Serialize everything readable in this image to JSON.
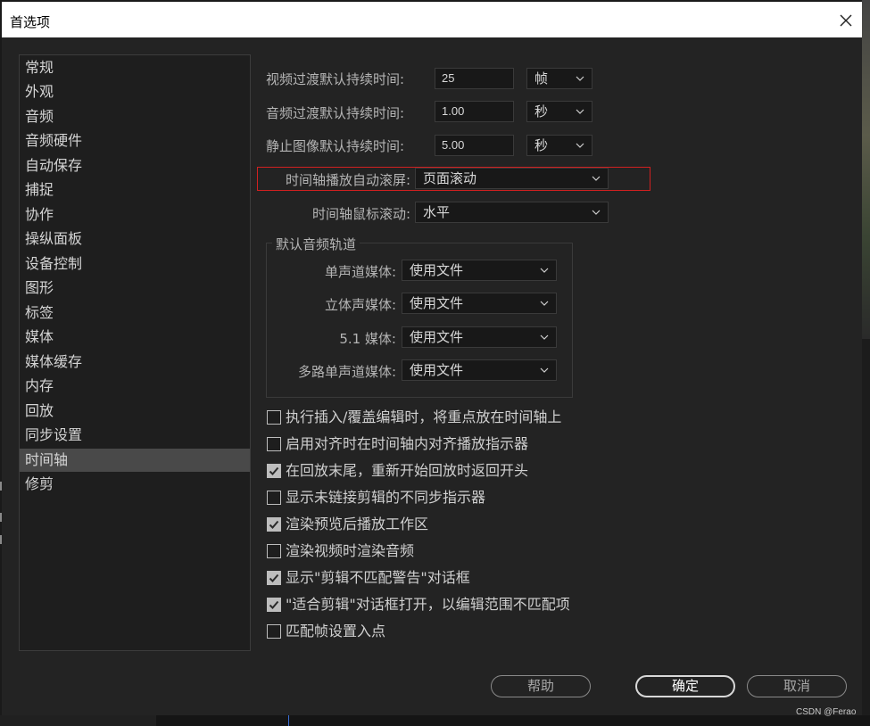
{
  "window": {
    "title": "首选项",
    "close_icon": "close-icon"
  },
  "sidebar": {
    "items": [
      {
        "label": "常规"
      },
      {
        "label": "外观"
      },
      {
        "label": "音频"
      },
      {
        "label": "音频硬件"
      },
      {
        "label": "自动保存"
      },
      {
        "label": "捕捉"
      },
      {
        "label": "协作"
      },
      {
        "label": "操纵面板"
      },
      {
        "label": "设备控制"
      },
      {
        "label": "图形"
      },
      {
        "label": "标签"
      },
      {
        "label": "媒体"
      },
      {
        "label": "媒体缓存"
      },
      {
        "label": "内存"
      },
      {
        "label": "回放"
      },
      {
        "label": "同步设置"
      },
      {
        "label": "时间轴"
      },
      {
        "label": "修剪"
      }
    ],
    "selected": "时间轴"
  },
  "timeline": {
    "video_transition": {
      "label": "视频过渡默认持续时间:",
      "value": "25",
      "unit": "帧"
    },
    "audio_transition": {
      "label": "音频过渡默认持续时间:",
      "value": "1.00",
      "unit": "秒"
    },
    "still_image": {
      "label": "静止图像默认持续时间:",
      "value": "5.00",
      "unit": "秒"
    },
    "playback_autoscroll": {
      "label": "时间轴播放自动滚屏:",
      "value": "页面滚动"
    },
    "mouse_scroll": {
      "label": "时间轴鼠标滚动:",
      "value": "水平"
    },
    "audio_tracks": {
      "title": "默认音频轨道",
      "mono": {
        "label": "单声道媒体:",
        "value": "使用文件"
      },
      "stereo": {
        "label": "立体声媒体:",
        "value": "使用文件"
      },
      "surround": {
        "label": "5.1 媒体:",
        "value": "使用文件"
      },
      "multi_mono": {
        "label": "多路单声道媒体:",
        "value": "使用文件"
      }
    },
    "checkboxes": [
      {
        "label": "执行插入/覆盖编辑时，将重点放在时间轴上",
        "checked": false
      },
      {
        "label": "启用对齐时在时间轴内对齐播放指示器",
        "checked": false
      },
      {
        "label": "在回放末尾，重新开始回放时返回开头",
        "checked": true
      },
      {
        "label": "显示未链接剪辑的不同步指示器",
        "checked": false
      },
      {
        "label": "渲染预览后播放工作区",
        "checked": true
      },
      {
        "label": "渲染视频时渲染音频",
        "checked": false
      },
      {
        "label": "显示\"剪辑不匹配警告\"对话框",
        "checked": true
      },
      {
        "label": "\"适合剪辑\"对话框打开，以编辑范围不匹配项",
        "checked": true
      },
      {
        "label": "匹配帧设置入点",
        "checked": false
      }
    ]
  },
  "buttons": {
    "help": "帮助",
    "ok": "确定",
    "cancel": "取消"
  },
  "watermark": "CSDN @Ferao",
  "colors": {
    "highlight_border": "#d02020",
    "dialog_bg": "#232323",
    "selected_item": "#494949"
  }
}
